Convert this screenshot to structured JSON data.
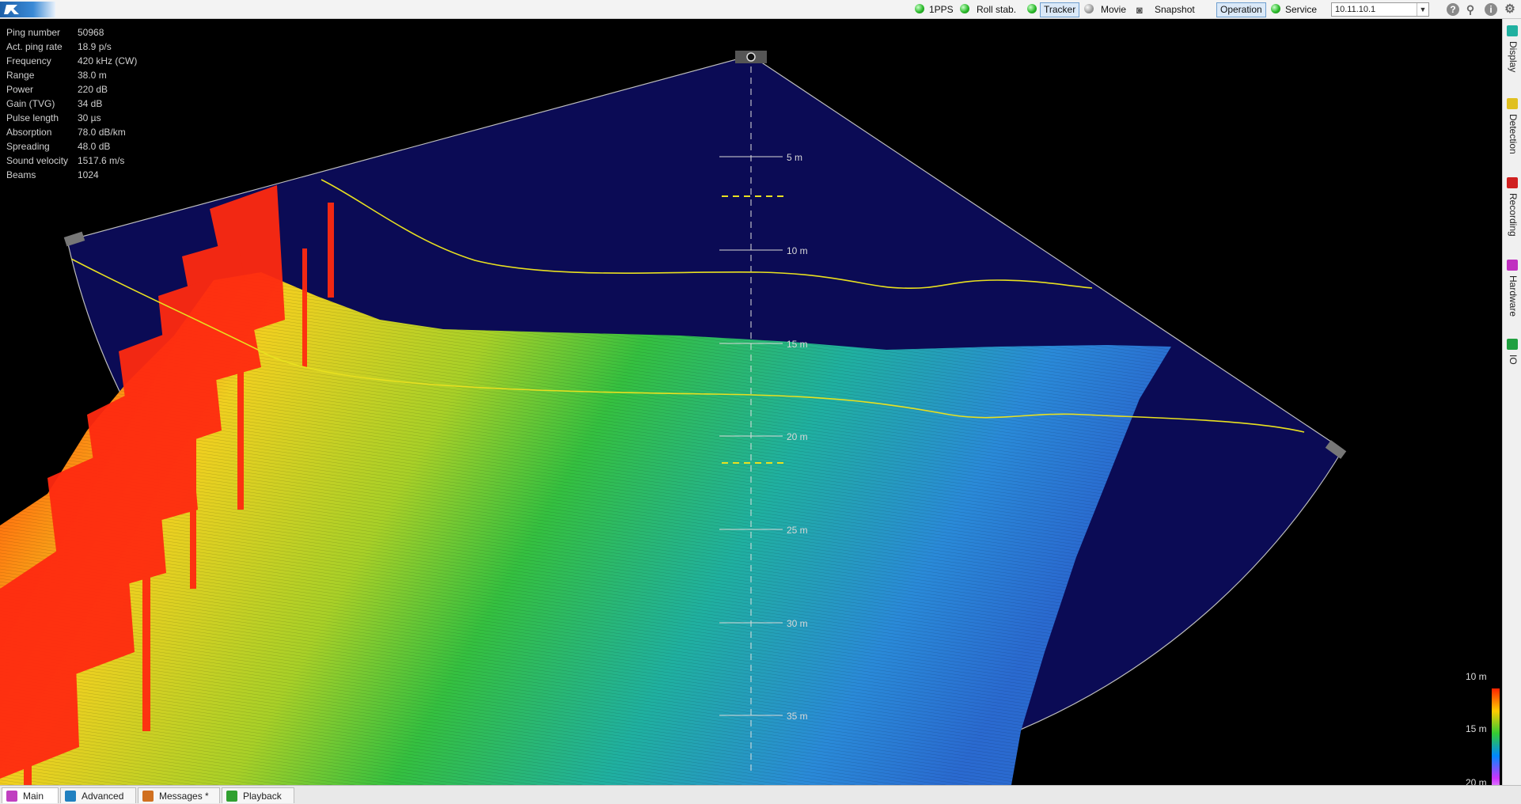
{
  "toolbar": {
    "indicators": [
      {
        "label": "1PPS",
        "state": "green"
      },
      {
        "label": "Roll stab.",
        "state": "green"
      },
      {
        "label": "Tracker",
        "state": "green"
      },
      {
        "label": "Movie",
        "state": "grey"
      },
      {
        "label": "Snapshot",
        "state": "camera"
      },
      {
        "label": "Operation",
        "state": "selected"
      },
      {
        "label": "Service",
        "state": "green"
      }
    ],
    "ip_address": "10.11.10.1",
    "help_icon": "?",
    "search_icon": "search-icon",
    "info_icon": "i",
    "settings_icon": "gear-icon"
  },
  "side_tabs": [
    "Display",
    "Detection",
    "Recording",
    "Hardware",
    "IO"
  ],
  "info_panel": [
    {
      "key": "Ping number",
      "value": "50968"
    },
    {
      "key": "Act. ping rate",
      "value": "18.9 p/s"
    },
    {
      "key": "Frequency",
      "value": "420 kHz (CW)"
    },
    {
      "key": "Range",
      "value": "38.0 m"
    },
    {
      "key": "Power",
      "value": "220 dB"
    },
    {
      "key": "Gain (TVG)",
      "value": "34 dB"
    },
    {
      "key": "Pulse length",
      "value": "30 µs"
    },
    {
      "key": "Absorption",
      "value": "78.0 dB/km"
    },
    {
      "key": "Spreading",
      "value": "48.0 dB"
    },
    {
      "key": "Sound velocity",
      "value": "1517.6 m/s"
    },
    {
      "key": "Beams",
      "value": "1024"
    }
  ],
  "range_rings": [
    "5 m",
    "10 m",
    "15 m",
    "20 m",
    "25 m",
    "30 m",
    "35 m"
  ],
  "color_scale": {
    "top": "10 m",
    "middle": "15 m",
    "bottom": "20 m"
  },
  "bottom_tabs": [
    {
      "label": "Main",
      "active": true
    },
    {
      "label": "Advanced",
      "active": false
    },
    {
      "label": "Messages *",
      "active": false
    },
    {
      "label": "Playback",
      "active": false
    }
  ],
  "colors": {
    "fan_fill": "#0b0b55",
    "track_line": "#e8e020",
    "near_seafloor": "#ff2a10",
    "far_seafloor": "#2a7fe0"
  }
}
